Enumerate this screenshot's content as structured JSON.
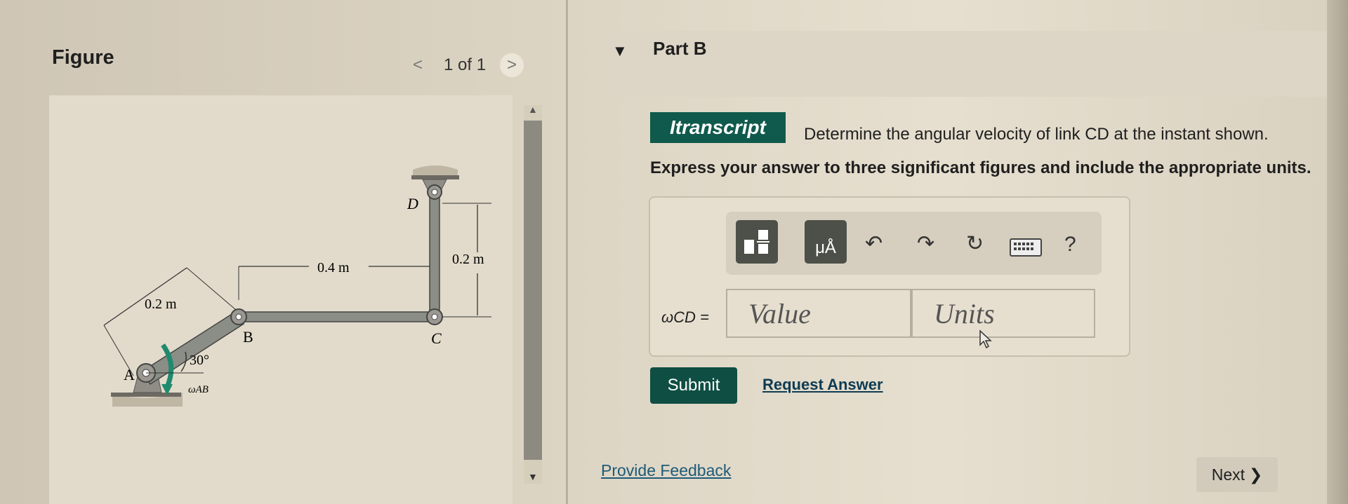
{
  "figure": {
    "title": "Figure",
    "pager_text": "1 of 1",
    "prev_glyph": "<",
    "next_glyph": ">",
    "labels": {
      "a": "A",
      "b": "B",
      "c": "C",
      "d": "D",
      "dim_ab": "0.2 m",
      "dim_bc": "0.4 m",
      "dim_cd": "0.2 m",
      "angle": "30°",
      "omega_ab": "ωAB"
    }
  },
  "part": {
    "title": "Part B",
    "transcript_label": "Itranscript",
    "question": "Determine the angular velocity of link CD at the instant shown.",
    "instructions": "Express your answer to three significant figures and include the appropriate units."
  },
  "toolbar": {
    "templates_icon": "templates-icon",
    "units_icon": "units-icon",
    "units_glyph": "μÅ",
    "undo_glyph": "↶",
    "redo_glyph": "↷",
    "reset_glyph": "↻",
    "keyboard_icon": "keyboard-icon",
    "help_glyph": "?"
  },
  "answer": {
    "label": "ωCD =",
    "value_placeholder": "Value",
    "units_placeholder": "Units"
  },
  "actions": {
    "submit": "Submit",
    "request_answer": "Request Answer",
    "provide_feedback": "Provide Feedback",
    "next": "Next",
    "next_glyph": "❯"
  },
  "colors": {
    "accent": "#0f5a4c",
    "submit": "#0f4e43",
    "link": "#0e3b52",
    "omega_arrow": "#1f8a6e"
  }
}
